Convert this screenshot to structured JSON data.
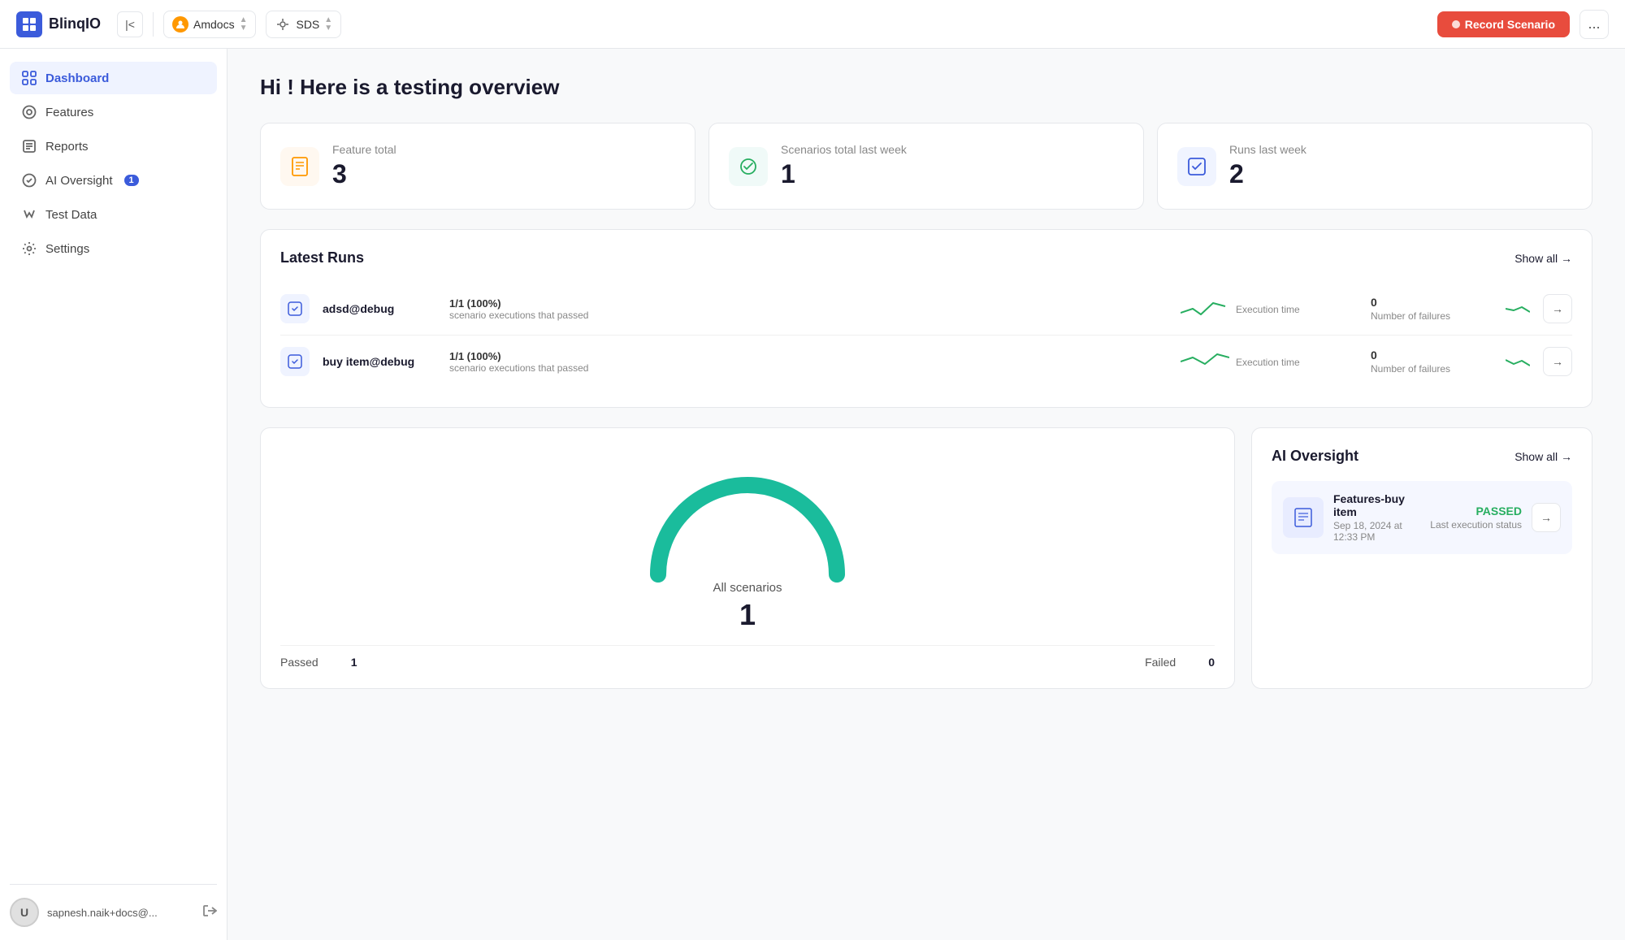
{
  "app": {
    "name": "BlinqIO"
  },
  "topbar": {
    "collapse_label": "|<",
    "org_name": "Amdocs",
    "env_name": "SDS",
    "record_btn": "Record Scenario",
    "more_btn": "..."
  },
  "sidebar": {
    "items": [
      {
        "id": "dashboard",
        "label": "Dashboard",
        "active": true
      },
      {
        "id": "features",
        "label": "Features",
        "active": false
      },
      {
        "id": "reports",
        "label": "Reports",
        "active": false
      },
      {
        "id": "ai-oversight",
        "label": "AI Oversight",
        "active": false,
        "badge": "1"
      },
      {
        "id": "test-data",
        "label": "Test Data",
        "active": false
      },
      {
        "id": "settings",
        "label": "Settings",
        "active": false
      }
    ],
    "user_email": "sapnesh.naik+docs@..."
  },
  "main": {
    "greeting": "Hi ! Here is a testing overview",
    "stats": [
      {
        "id": "feature-total",
        "label": "Feature total",
        "value": "3",
        "icon_type": "orange"
      },
      {
        "id": "scenarios-total",
        "label": "Scenarios total last week",
        "value": "1",
        "icon_type": "teal"
      },
      {
        "id": "runs-last-week",
        "label": "Runs last week",
        "value": "2",
        "icon_type": "blue"
      }
    ],
    "latest_runs": {
      "title": "Latest Runs",
      "show_all": "Show all →",
      "runs": [
        {
          "name": "adsd@debug",
          "pct": "1/1 (100%)",
          "sub": "scenario executions that passed",
          "exec_time_label": "Execution time",
          "failures": "0",
          "failures_label": "Number of failures"
        },
        {
          "name": "buy item@debug",
          "pct": "1/1 (100%)",
          "sub": "scenario executions that passed",
          "exec_time_label": "Execution time",
          "failures": "0",
          "failures_label": "Number of failures"
        }
      ]
    },
    "gauge": {
      "label": "All scenarios",
      "value": "1",
      "passed_label": "Passed",
      "passed_value": "1",
      "failed_label": "Failed",
      "failed_value": "0"
    },
    "ai_oversight": {
      "title": "AI Oversight",
      "show_all": "Show all →",
      "items": [
        {
          "name": "Features-buy item",
          "date": "Sep 18, 2024 at 12:33 PM",
          "status": "PASSED",
          "last_exec": "Last execution status"
        }
      ]
    }
  }
}
